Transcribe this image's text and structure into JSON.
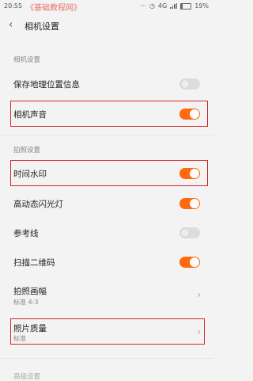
{
  "status": {
    "time": "20:55",
    "watermark": "《基础教程网》",
    "network": "4G",
    "battery": "19%"
  },
  "header": {
    "title": "相机设置"
  },
  "sections": [
    {
      "label": "相机设置",
      "items": [
        {
          "label": "保存地理位置信息",
          "type": "toggle",
          "on": false
        },
        {
          "label": "相机声音",
          "type": "toggle",
          "on": true,
          "highlighted": true
        }
      ]
    },
    {
      "label": "拍照设置",
      "items": [
        {
          "label": "时间水印",
          "type": "toggle",
          "on": true,
          "highlighted": true
        },
        {
          "label": "高动态闪光灯",
          "type": "toggle",
          "on": true
        },
        {
          "label": "参考线",
          "type": "toggle",
          "on": false
        },
        {
          "label": "扫描二维码",
          "type": "toggle",
          "on": true
        },
        {
          "label": "拍照画幅",
          "sublabel": "标准 4:3",
          "type": "link"
        },
        {
          "label": "照片质量",
          "sublabel": "标准",
          "type": "link",
          "highlighted": true
        }
      ]
    },
    {
      "label": "高级设置"
    }
  ],
  "colors": {
    "accent": "#ff6a10",
    "highlight_box": "#d22a2a",
    "background": "#f3f3f3"
  }
}
